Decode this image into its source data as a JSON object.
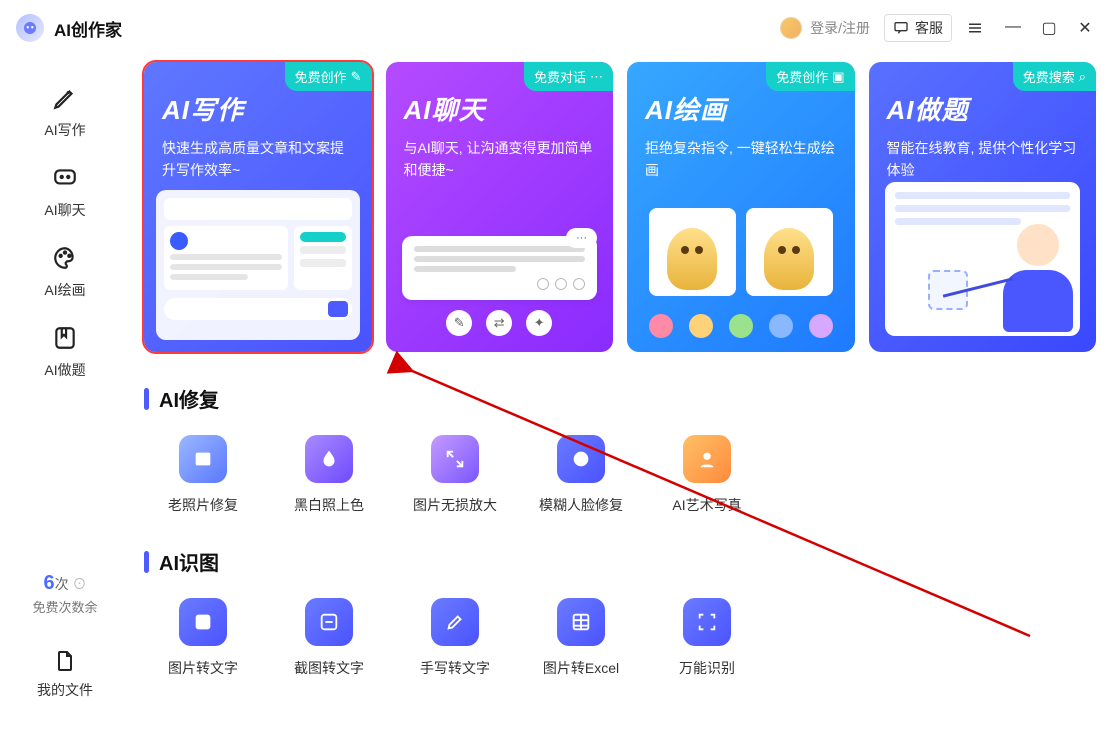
{
  "app": {
    "title": "AI创作家",
    "login": "登录/注册",
    "kefu": "客服"
  },
  "sidebar": {
    "items": [
      {
        "label": "AI写作"
      },
      {
        "label": "AI聊天"
      },
      {
        "label": "AI绘画"
      },
      {
        "label": "AI做题"
      }
    ],
    "free": {
      "count": "6",
      "unit": "次",
      "sub": "免费次数余"
    },
    "files": "我的文件"
  },
  "cards": [
    {
      "title": "AI写作",
      "desc": "快速生成高质量文章和文案提升写作效率~",
      "badge": "免费创作"
    },
    {
      "title": "AI聊天",
      "desc": "与AI聊天, 让沟通变得更加简单和便捷~",
      "badge": "免费对话"
    },
    {
      "title": "AI绘画",
      "desc": "拒绝复杂指令, 一键轻松生成绘画",
      "badge": "免费创作"
    },
    {
      "title": "AI做题",
      "desc": "智能在线教育, 提供个性化学习体验",
      "badge": "免费搜索"
    }
  ],
  "sections": {
    "repair": {
      "heading": "AI修复",
      "tools": [
        "老照片修复",
        "黑白照上色",
        "图片无损放大",
        "模糊人脸修复",
        "AI艺术写真"
      ]
    },
    "ocr": {
      "heading": "AI识图",
      "tools": [
        "图片转文字",
        "截图转文字",
        "手写转文字",
        "图片转Excel",
        "万能识别"
      ]
    }
  }
}
